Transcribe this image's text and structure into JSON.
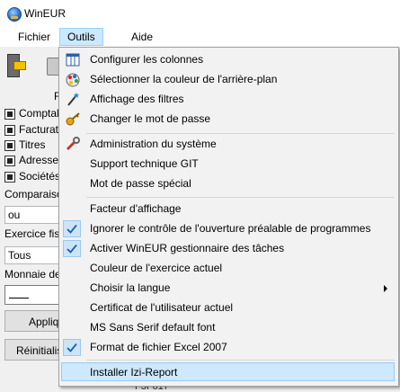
{
  "window": {
    "title": "WinEUR"
  },
  "menubar": {
    "items": [
      "Fichier",
      "Outils",
      "Aide"
    ]
  },
  "left_panel": {
    "f_label": "F",
    "checks": [
      "Comptal",
      "Facturat",
      "Titres",
      "Adresse",
      "Sociétés"
    ],
    "comparison_label": "Comparaiso",
    "comparison_value": "ou",
    "exercise_label": "Exercice fis",
    "exercise_value": "Tous",
    "currency_label": "Monnaie de",
    "apply_button": "Appliq",
    "reset_button": "Réinitialis"
  },
  "bottom_text": "F3F617",
  "outils_menu": {
    "items": [
      {
        "label": "Configurer les colonnes",
        "icon": "table-columns-icon"
      },
      {
        "label": "Sélectionner la couleur de l'arrière-plan",
        "icon": "color-palette-icon"
      },
      {
        "label": "Affichage des filtres",
        "icon": "magic-wand-icon"
      },
      {
        "label": "Changer le mot de passe",
        "icon": "key-icon"
      },
      {
        "label": "Administration du système",
        "icon": "wrench-icon"
      },
      {
        "label": "Support technique GIT",
        "icon": ""
      },
      {
        "label": "Mot de passe spécial",
        "icon": ""
      },
      {
        "label": "Facteur d'affichage",
        "icon": ""
      },
      {
        "label": "Ignorer le contrôle de l'ouverture préalable de programmes",
        "checked": true
      },
      {
        "label": "Activer WinEUR gestionnaire des tâches",
        "checked": true
      },
      {
        "label": "Couleur de l'exercice actuel"
      },
      {
        "label": "Choisir la langue",
        "submenu": true
      },
      {
        "label": "Certificat de l'utilisateur actuel"
      },
      {
        "label": "MS Sans Serif default font"
      },
      {
        "label": "Format de fichier Excel 2007",
        "checked": true
      },
      {
        "label": "Installer Izi-Report",
        "highlighted": true
      }
    ]
  },
  "colors": {
    "menu_highlight": "#cde8ff",
    "check_background": "#cce4f7"
  }
}
